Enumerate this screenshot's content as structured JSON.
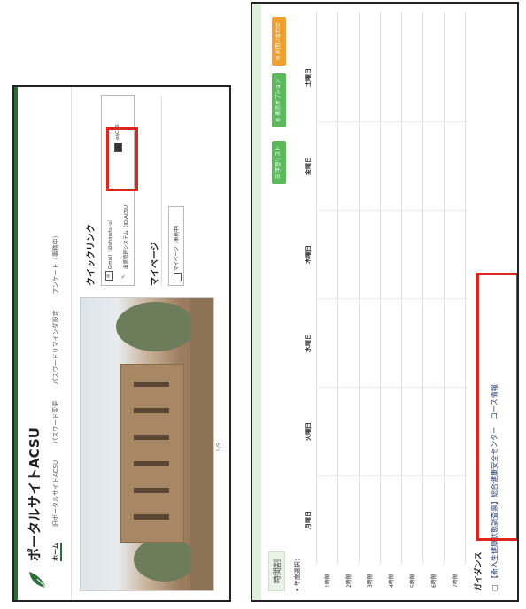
{
  "portal": {
    "title": "ポータルサイトACSU",
    "nav": [
      "ホーム",
      "旧ポータルサイトACSU",
      "パスワード変更",
      "パスワードリマインダ設定",
      "アンケート（事務中）"
    ],
    "hero_caption": "1/5",
    "quicklinks": {
      "title": "クイックリンク",
      "items": [
        "Gmail（@shinshu-u）",
        "出席管理システム（ID:ACSU）",
        "eACPS"
      ]
    },
    "mypage": {
      "title": "マイページ",
      "button": "マイページ（事務中）"
    }
  },
  "timetable": {
    "header": "時間割",
    "year_select": "年度選択：",
    "buttons": [
      "学習リスト",
      "表示オプション",
      "お問い合わせ"
    ],
    "days": [
      "月曜日",
      "火曜日",
      "水曜日",
      "木曜日",
      "金曜日",
      "土曜日"
    ],
    "periods": [
      "1時限",
      "2時限",
      "3時限",
      "4時限",
      "5時限",
      "6時限",
      "7時限"
    ],
    "guidance_title": "ガイダンス",
    "guidance_link": "【新入生健康状態調査票】総合健康安全センター　コース情報"
  },
  "colors": {
    "accent_green": "#2b6e3a",
    "button_green": "#5cb85c",
    "button_orange": "#f0a030",
    "highlight_red": "#e0251c"
  }
}
